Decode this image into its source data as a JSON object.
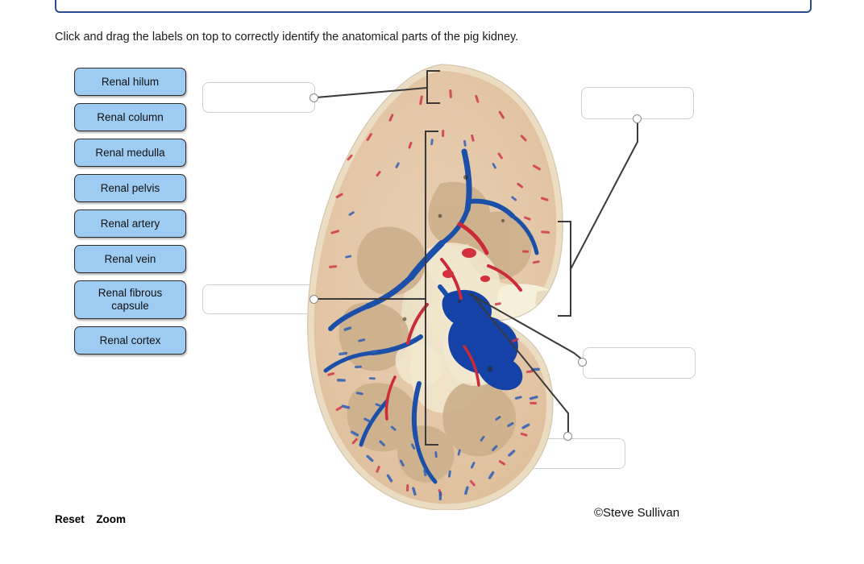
{
  "instruction": "Click and drag the labels on top to correctly identify the anatomical parts of the pig kidney.",
  "label_bank": {
    "items": [
      {
        "id": "renal-hilum",
        "label": "Renal hilum"
      },
      {
        "id": "renal-column",
        "label": "Renal column"
      },
      {
        "id": "renal-medulla",
        "label": "Renal medulla"
      },
      {
        "id": "renal-pelvis",
        "label": "Renal pelvis"
      },
      {
        "id": "renal-artery",
        "label": "Renal artery"
      },
      {
        "id": "renal-vein",
        "label": "Renal vein"
      },
      {
        "id": "renal-fibrous-capsule",
        "label": "Renal fibrous capsule"
      },
      {
        "id": "renal-cortex",
        "label": "Renal cortex"
      }
    ]
  },
  "drop_targets": [
    {
      "id": "drop-top-left",
      "value": "",
      "placeholder": ""
    },
    {
      "id": "drop-middle-left",
      "value": "",
      "placeholder": ""
    },
    {
      "id": "drop-top-right",
      "value": "",
      "placeholder": ""
    },
    {
      "id": "drop-middle-right",
      "value": "",
      "placeholder": ""
    },
    {
      "id": "drop-bottom-right",
      "value": "",
      "placeholder": ""
    }
  ],
  "controls": {
    "reset_label": "Reset",
    "zoom_label": "Zoom"
  },
  "credit": "©Steve Sullivan",
  "colors": {
    "label_fill": "#9ecbf2",
    "label_border": "#2b2b2b",
    "panel_border": "#2a4b8d",
    "leader_line": "#3a3a3a",
    "drop_border": "#cfcfcf"
  }
}
